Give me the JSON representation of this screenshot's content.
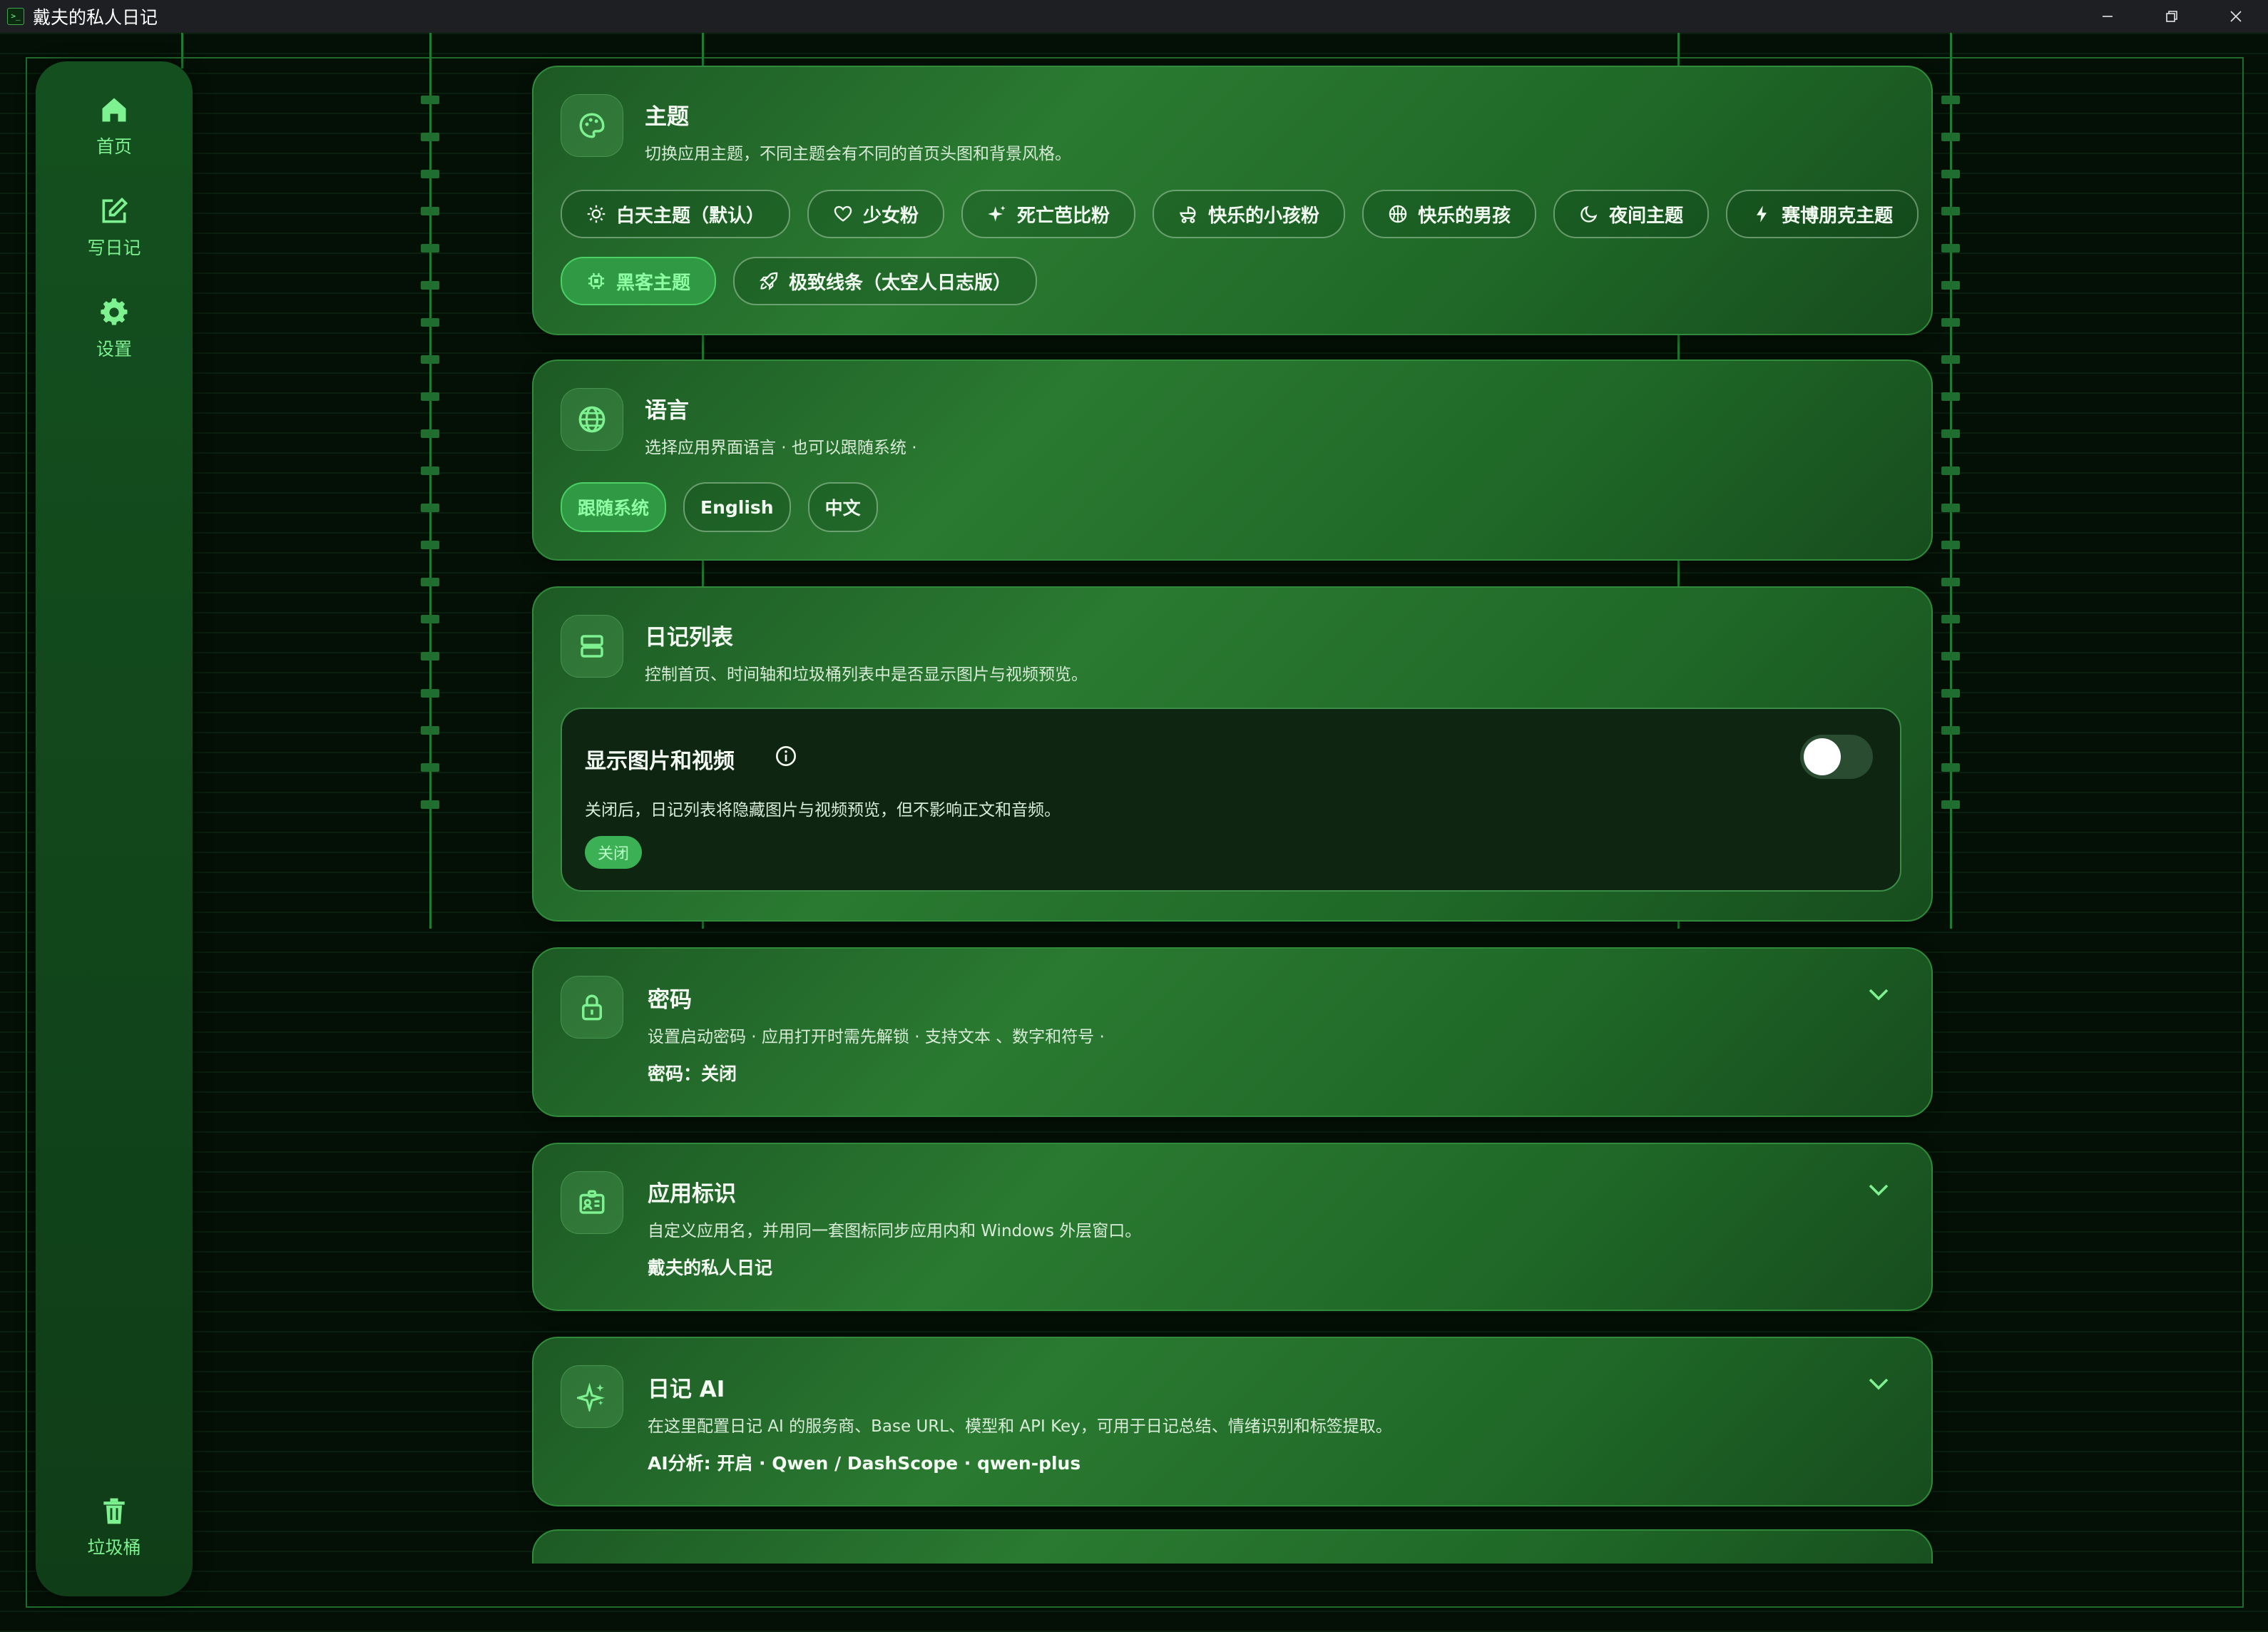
{
  "window": {
    "title": "戴夫的私人日记",
    "app_icon_text": ">_",
    "controls": [
      "minimize-icon",
      "restore-icon",
      "close-icon"
    ]
  },
  "colors": {
    "accent": "#7ef190",
    "card_bg": "#2a7a31",
    "inner_panel_bg": "#0e2512",
    "background": "#041006"
  },
  "sidebar": {
    "items": [
      {
        "label": "首页",
        "icon": "home-icon"
      },
      {
        "label": "写日记",
        "icon": "edit-icon"
      },
      {
        "label": "设置",
        "icon": "gear-icon"
      }
    ],
    "bottom": {
      "label": "垃圾桶",
      "icon": "trash-icon"
    }
  },
  "theme": {
    "title": "主题",
    "desc": "切换应用主题，不同主题会有不同的首页头图和背景风格。",
    "options": [
      {
        "label": "白天主题（默认）",
        "icon": "sun-icon",
        "active": false
      },
      {
        "label": "少女粉",
        "icon": "heart-icon",
        "active": false
      },
      {
        "label": "死亡芭比粉",
        "icon": "sparkle-icon",
        "active": false
      },
      {
        "label": "快乐的小孩粉",
        "icon": "baby-carriage-icon",
        "active": false
      },
      {
        "label": "快乐的男孩",
        "icon": "basketball-icon",
        "active": false
      },
      {
        "label": "夜间主题",
        "icon": "moon-icon",
        "active": false
      },
      {
        "label": "赛博朋克主题",
        "icon": "bolt-icon",
        "active": false
      },
      {
        "label": "黑客主题",
        "icon": "chip-icon",
        "active": true
      },
      {
        "label": "极致线条（太空人日志版）",
        "icon": "rocket-icon",
        "active": false
      }
    ]
  },
  "language": {
    "title": "语言",
    "desc": "选择应用界面语言 · 也可以跟随系统 ·",
    "options": [
      {
        "label": "跟随系统",
        "active": true
      },
      {
        "label": "English",
        "active": false
      },
      {
        "label": "中文",
        "active": false
      }
    ]
  },
  "diary_list": {
    "title": "日记列表",
    "desc": "控制首页、时间轴和垃圾桶列表中是否显示图片与视频预览。",
    "setting": {
      "title": "显示图片和视频",
      "desc": "关闭后，日记列表将隐藏图片与视频预览，但不影响正文和音频。",
      "status": "关闭",
      "enabled": false
    }
  },
  "password": {
    "title": "密码",
    "desc": "设置启动密码 · 应用打开时需先解锁 · 支持文本 、数字和符号 ·",
    "summary": "密码：关闭"
  },
  "app_identity": {
    "title": "应用标识",
    "desc": "自定义应用名，并用同一套图标同步应用内和 Windows 外层窗口。",
    "summary": "戴夫的私人日记"
  },
  "diary_ai": {
    "title": "日记 AI",
    "desc": "在这里配置日记 AI 的服务商、Base URL、模型和 API Key，可用于日记总结、情绪识别和标签提取。",
    "summary": "AI分析: 开启 · Qwen / DashScope · qwen-plus"
  }
}
